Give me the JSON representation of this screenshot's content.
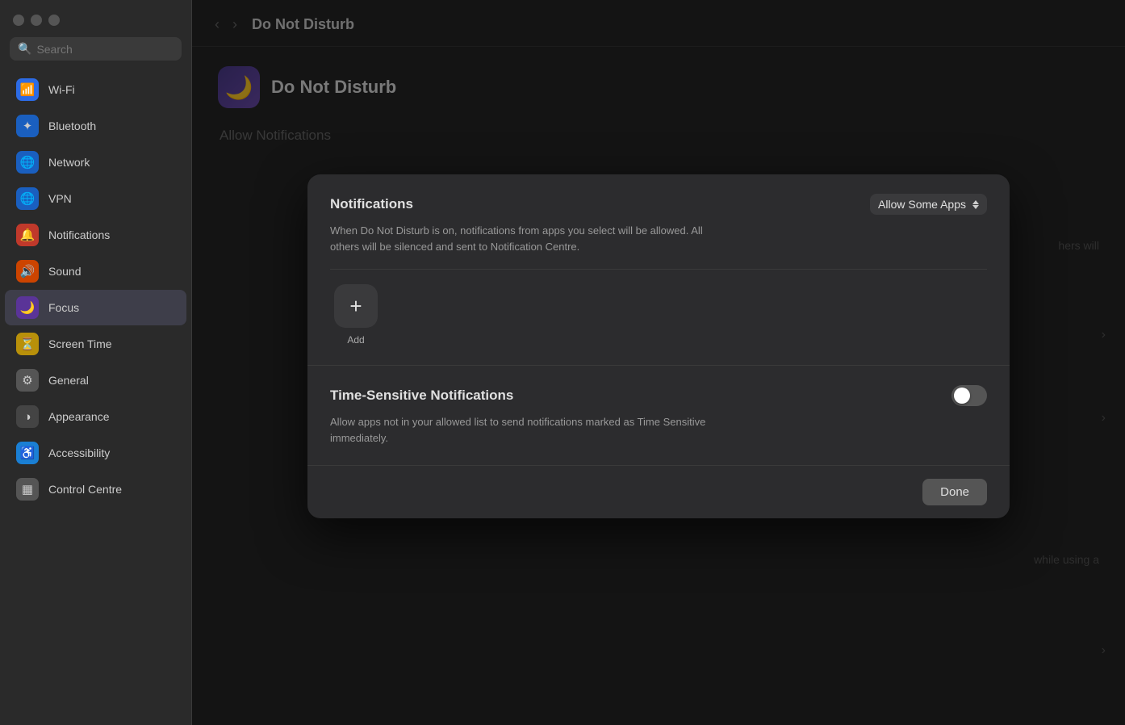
{
  "window": {
    "title": "Do Not Disturb"
  },
  "sidebar": {
    "search_placeholder": "Search",
    "items": [
      {
        "id": "wifi",
        "label": "Wi-Fi",
        "icon": "📶",
        "icon_class": "icon-blue",
        "active": false
      },
      {
        "id": "bluetooth",
        "label": "Bluetooth",
        "icon": "⬡",
        "icon_class": "icon-blue-dark",
        "active": false
      },
      {
        "id": "network",
        "label": "Network",
        "icon": "🌐",
        "icon_class": "icon-blue-dark",
        "active": false
      },
      {
        "id": "vpn",
        "label": "VPN",
        "icon": "🌐",
        "icon_class": "icon-blue-dark",
        "active": false
      },
      {
        "id": "notifications",
        "label": "Notifications",
        "icon": "🔔",
        "icon_class": "icon-red",
        "active": false
      },
      {
        "id": "sound",
        "label": "Sound",
        "icon": "🔊",
        "icon_class": "icon-orange-red",
        "active": false
      },
      {
        "id": "focus",
        "label": "Focus",
        "icon": "🌙",
        "icon_class": "icon-purple",
        "active": true
      },
      {
        "id": "screen-time",
        "label": "Screen Time",
        "icon": "⏳",
        "icon_class": "icon-yellow",
        "active": false
      },
      {
        "id": "general",
        "label": "General",
        "icon": "⚙️",
        "icon_class": "icon-gray",
        "active": false
      },
      {
        "id": "appearance",
        "label": "Appearance",
        "icon": "◑",
        "icon_class": "icon-dark-gray",
        "active": false
      },
      {
        "id": "accessibility",
        "label": "Accessibility",
        "icon": "♿",
        "icon_class": "icon-blue",
        "active": false
      },
      {
        "id": "control-centre",
        "label": "Control Centre",
        "icon": "⊞",
        "icon_class": "icon-gray",
        "active": false
      }
    ]
  },
  "main": {
    "title": "Do Not Disturb",
    "dnd_label": "Do Not Disturb",
    "allow_notifications_label": "Allow Notifications",
    "bg_text_right_1": "hers will",
    "bg_text_right_2": "while using a"
  },
  "modal": {
    "notifications_section": {
      "title": "Notifications",
      "description": "When Do Not Disturb is on, notifications from apps you select will be allowed. All others will be silenced and sent to Notification Centre.",
      "allow_select_label": "Allow Some Apps",
      "add_label": "Add"
    },
    "time_sensitive_section": {
      "title": "Time-Sensitive Notifications",
      "description": "Allow apps not in your allowed list to send notifications marked as Time Sensitive immediately.",
      "toggle_on": false
    },
    "done_label": "Done"
  }
}
